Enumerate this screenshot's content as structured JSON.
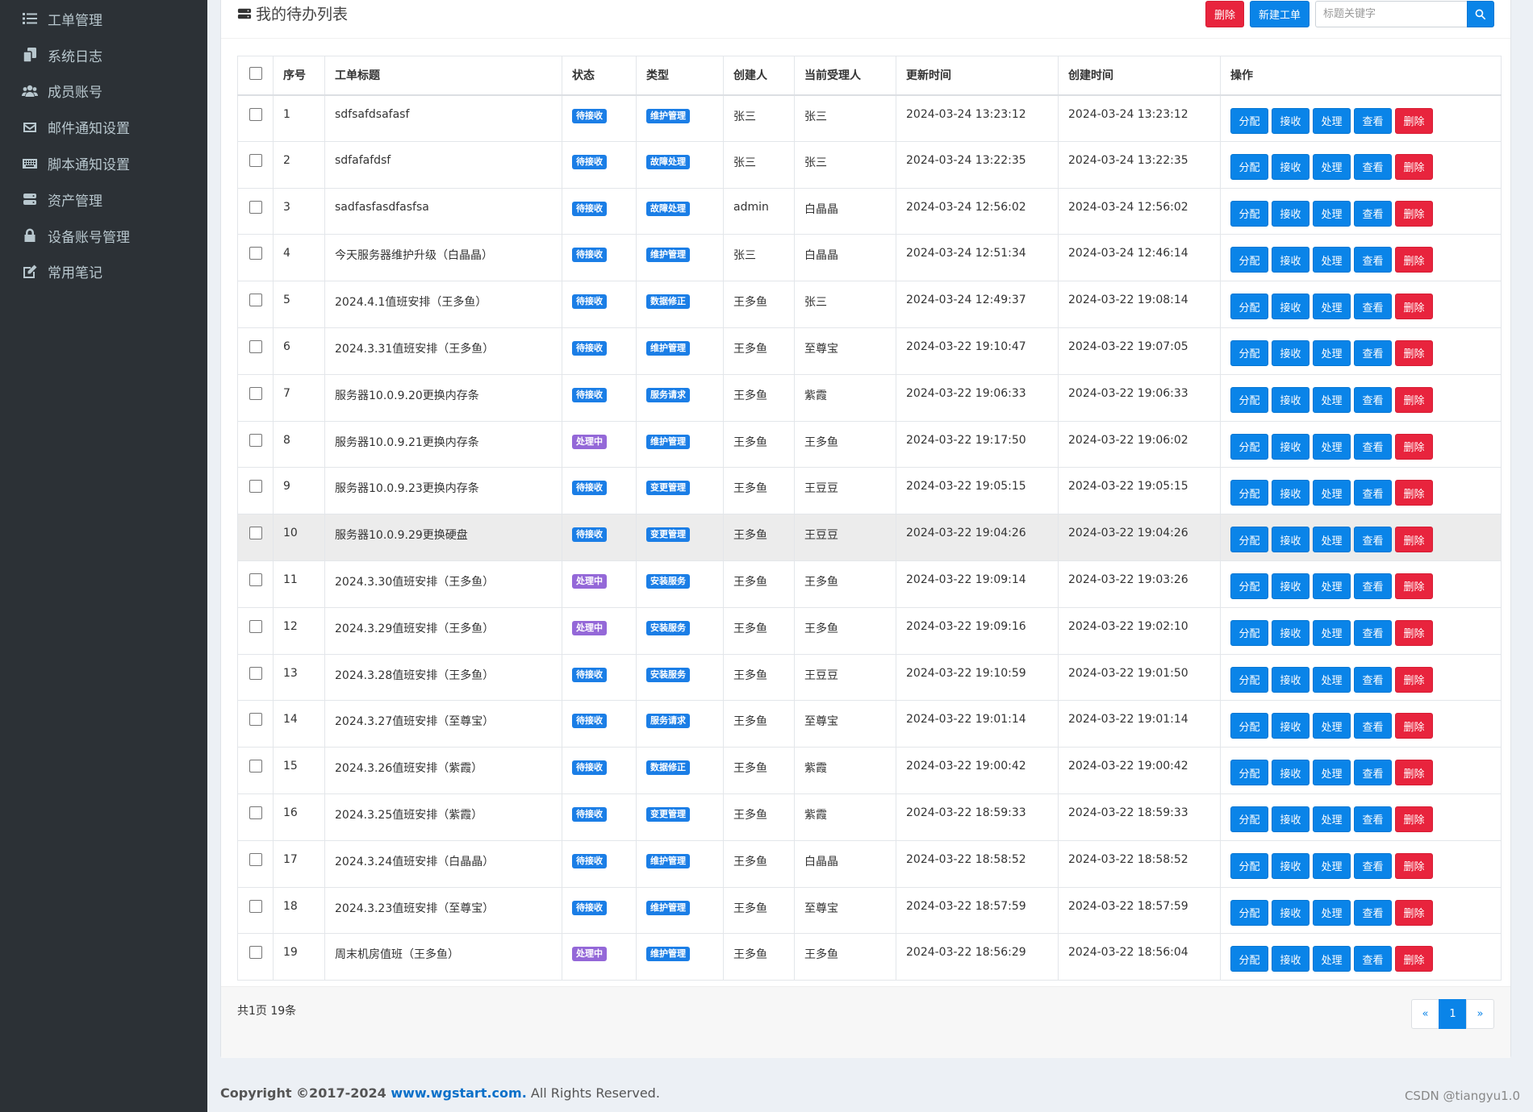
{
  "sidebar": {
    "items": [
      {
        "label": "工单管理",
        "icon": "list-icon"
      },
      {
        "label": "系统日志",
        "icon": "copy-icon"
      },
      {
        "label": "成员账号",
        "icon": "users-icon"
      },
      {
        "label": "邮件通知设置",
        "icon": "envelope-icon"
      },
      {
        "label": "脚本通知设置",
        "icon": "keyboard-icon"
      },
      {
        "label": "资产管理",
        "icon": "server-icon"
      },
      {
        "label": "设备账号管理",
        "icon": "lock-icon"
      },
      {
        "label": "常用笔记",
        "icon": "edit-icon"
      }
    ]
  },
  "header": {
    "title": "我的待办列表",
    "delete_label": "删除",
    "new_label": "新建工单",
    "search_placeholder": "标题关键字"
  },
  "table": {
    "columns": [
      "序号",
      "工单标题",
      "状态",
      "类型",
      "创建人",
      "当前受理人",
      "更新时间",
      "创建时间",
      "操作"
    ],
    "actions": [
      "分配",
      "接收",
      "处理",
      "查看",
      "删除"
    ],
    "rows": [
      {
        "no": "1",
        "title": "sdfsafdsafasf",
        "status": "待接收",
        "status_color": "blue",
        "type": "维护管理",
        "creator": "张三",
        "assignee": "张三",
        "updated": "2024-03-24 13:23:12",
        "created": "2024-03-24 13:23:12"
      },
      {
        "no": "2",
        "title": "sdfafafdsf",
        "status": "待接收",
        "status_color": "blue",
        "type": "故障处理",
        "creator": "张三",
        "assignee": "张三",
        "updated": "2024-03-24 13:22:35",
        "created": "2024-03-24 13:22:35"
      },
      {
        "no": "3",
        "title": "sadfasfasdfasfsa",
        "status": "待接收",
        "status_color": "blue",
        "type": "故障处理",
        "creator": "admin",
        "assignee": "白晶晶",
        "updated": "2024-03-24 12:56:02",
        "created": "2024-03-24 12:56:02"
      },
      {
        "no": "4",
        "title": "今天服务器维护升级（白晶晶）",
        "status": "待接收",
        "status_color": "blue",
        "type": "维护管理",
        "creator": "张三",
        "assignee": "白晶晶",
        "updated": "2024-03-24 12:51:34",
        "created": "2024-03-24 12:46:14"
      },
      {
        "no": "5",
        "title": "2024.4.1值班安排（王多鱼）",
        "status": "待接收",
        "status_color": "blue",
        "type": "数据修正",
        "creator": "王多鱼",
        "assignee": "张三",
        "updated": "2024-03-24 12:49:37",
        "created": "2024-03-22 19:08:14"
      },
      {
        "no": "6",
        "title": "2024.3.31值班安排（王多鱼）",
        "status": "待接收",
        "status_color": "blue",
        "type": "维护管理",
        "creator": "王多鱼",
        "assignee": "至尊宝",
        "updated": "2024-03-22 19:10:47",
        "created": "2024-03-22 19:07:05"
      },
      {
        "no": "7",
        "title": "服务器10.0.9.20更换内存条",
        "status": "待接收",
        "status_color": "blue",
        "type": "服务请求",
        "creator": "王多鱼",
        "assignee": "紫霞",
        "updated": "2024-03-22 19:06:33",
        "created": "2024-03-22 19:06:33"
      },
      {
        "no": "8",
        "title": "服务器10.0.9.21更换内存条",
        "status": "处理中",
        "status_color": "purple",
        "type": "维护管理",
        "creator": "王多鱼",
        "assignee": "王多鱼",
        "updated": "2024-03-22 19:17:50",
        "created": "2024-03-22 19:06:02"
      },
      {
        "no": "9",
        "title": "服务器10.0.9.23更换内存条",
        "status": "待接收",
        "status_color": "blue",
        "type": "变更管理",
        "creator": "王多鱼",
        "assignee": "王豆豆",
        "updated": "2024-03-22 19:05:15",
        "created": "2024-03-22 19:05:15"
      },
      {
        "no": "10",
        "title": "服务器10.0.9.29更换硬盘",
        "status": "待接收",
        "status_color": "blue",
        "type": "变更管理",
        "creator": "王多鱼",
        "assignee": "王豆豆",
        "updated": "2024-03-22 19:04:26",
        "created": "2024-03-22 19:04:26"
      },
      {
        "no": "11",
        "title": "2024.3.30值班安排（王多鱼）",
        "status": "处理中",
        "status_color": "purple",
        "type": "安装服务",
        "creator": "王多鱼",
        "assignee": "王多鱼",
        "updated": "2024-03-22 19:09:14",
        "created": "2024-03-22 19:03:26"
      },
      {
        "no": "12",
        "title": "2024.3.29值班安排（王多鱼）",
        "status": "处理中",
        "status_color": "purple",
        "type": "安装服务",
        "creator": "王多鱼",
        "assignee": "王多鱼",
        "updated": "2024-03-22 19:09:16",
        "created": "2024-03-22 19:02:10"
      },
      {
        "no": "13",
        "title": "2024.3.28值班安排（王多鱼）",
        "status": "待接收",
        "status_color": "blue",
        "type": "安装服务",
        "creator": "王多鱼",
        "assignee": "王豆豆",
        "updated": "2024-03-22 19:10:59",
        "created": "2024-03-22 19:01:50"
      },
      {
        "no": "14",
        "title": "2024.3.27值班安排（至尊宝）",
        "status": "待接收",
        "status_color": "blue",
        "type": "服务请求",
        "creator": "王多鱼",
        "assignee": "至尊宝",
        "updated": "2024-03-22 19:01:14",
        "created": "2024-03-22 19:01:14"
      },
      {
        "no": "15",
        "title": "2024.3.26值班安排（紫霞）",
        "status": "待接收",
        "status_color": "blue",
        "type": "数据修正",
        "creator": "王多鱼",
        "assignee": "紫霞",
        "updated": "2024-03-22 19:00:42",
        "created": "2024-03-22 19:00:42"
      },
      {
        "no": "16",
        "title": "2024.3.25值班安排（紫霞）",
        "status": "待接收",
        "status_color": "blue",
        "type": "变更管理",
        "creator": "王多鱼",
        "assignee": "紫霞",
        "updated": "2024-03-22 18:59:33",
        "created": "2024-03-22 18:59:33"
      },
      {
        "no": "17",
        "title": "2024.3.24值班安排（白晶晶）",
        "status": "待接收",
        "status_color": "blue",
        "type": "维护管理",
        "creator": "王多鱼",
        "assignee": "白晶晶",
        "updated": "2024-03-22 18:58:52",
        "created": "2024-03-22 18:58:52"
      },
      {
        "no": "18",
        "title": "2024.3.23值班安排（至尊宝）",
        "status": "待接收",
        "status_color": "blue",
        "type": "维护管理",
        "creator": "王多鱼",
        "assignee": "至尊宝",
        "updated": "2024-03-22 18:57:59",
        "created": "2024-03-22 18:57:59"
      },
      {
        "no": "19",
        "title": "周末机房值班（王多鱼）",
        "status": "处理中",
        "status_color": "purple",
        "type": "维护管理",
        "creator": "王多鱼",
        "assignee": "王多鱼",
        "updated": "2024-03-22 18:56:29",
        "created": "2024-03-22 18:56:04"
      }
    ],
    "highlighted_row": "10"
  },
  "pagination": {
    "summary": "共1页 19条",
    "prev": "«",
    "current": "1",
    "next": "»"
  },
  "footer": {
    "copyright_prefix": "Copyright ©2017-2024 ",
    "link": "www.wgstart.com.",
    "suffix": " All Rights Reserved.",
    "watermark": "CSDN @tiangyu1.0"
  },
  "colors": {
    "sidebar_bg": "#2c3136",
    "primary": "#0a84e8",
    "danger": "#e8243d",
    "status_blue": "#1b7ee6",
    "status_purple": "#9468d8"
  }
}
